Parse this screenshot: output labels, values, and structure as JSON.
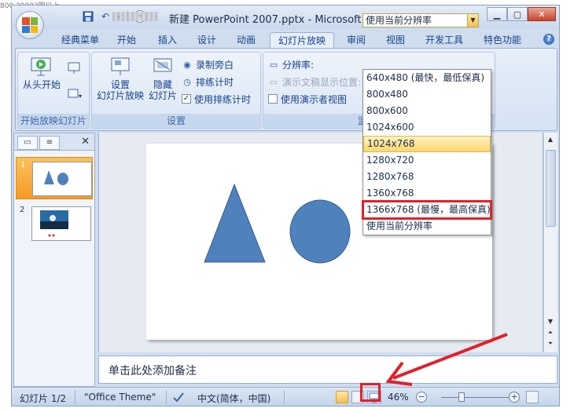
{
  "cut_label": "800,29092图以上",
  "window": {
    "title": "新建 PowerPoint 2007.pptx - Microsoft PowerPoint",
    "controls": {
      "minimize": "▁",
      "maximize": "▢",
      "close": "✕"
    }
  },
  "tabs": [
    "经典菜单",
    "开始",
    "插入",
    "设计",
    "动画",
    "幻灯片放映",
    "审阅",
    "视图",
    "开发工具",
    "特色功能"
  ],
  "active_tab": "幻灯片放映",
  "help": "?",
  "ribbon": {
    "group1": {
      "label": "开始放映幻灯片",
      "from_start": "从头开始"
    },
    "group2": {
      "label": "设置",
      "setup_line1": "设置",
      "setup_line2": "幻灯片放映",
      "hide_line1": "隐藏",
      "hide_line2": "幻灯片",
      "record": "录制旁白",
      "rehearse": "排练计时",
      "use_timing": "使用排练计时"
    },
    "group3": {
      "label": "监",
      "resolution_label": "分辨率:",
      "resolution_value": "使用当前分辨率",
      "show_on": "演示文稿显示位置:",
      "presenter_view": "使用演示者视图"
    }
  },
  "dropdown": {
    "items": [
      "640x480 (最快，最低保真)",
      "800x480",
      "800x600",
      "1024x600",
      "1024x768",
      "1280x720",
      "1280x768",
      "1360x768",
      "1366x768 (最慢，最高保真)",
      "使用当前分辨率"
    ],
    "hover_index": 4,
    "marked_index": 8,
    "mark_color": "#e0202a",
    "hover_color": "#fbd56b"
  },
  "slides_pane": {
    "close": "✕",
    "slides": [
      {
        "number": "1",
        "selected": true
      },
      {
        "number": "2",
        "selected": false
      }
    ]
  },
  "slide": {
    "shape_color": "#4f81bd",
    "shape_border": "#385d8a"
  },
  "notes": {
    "placeholder": "单击此处添加备注"
  },
  "status": {
    "slide_info": "幻灯片 1/2",
    "theme": "\"Office Theme\"",
    "language": "中文(简体，中国)",
    "zoom": "46%",
    "zoom_minus": "−",
    "zoom_plus": "+"
  },
  "annotation_color": "#e0202a"
}
